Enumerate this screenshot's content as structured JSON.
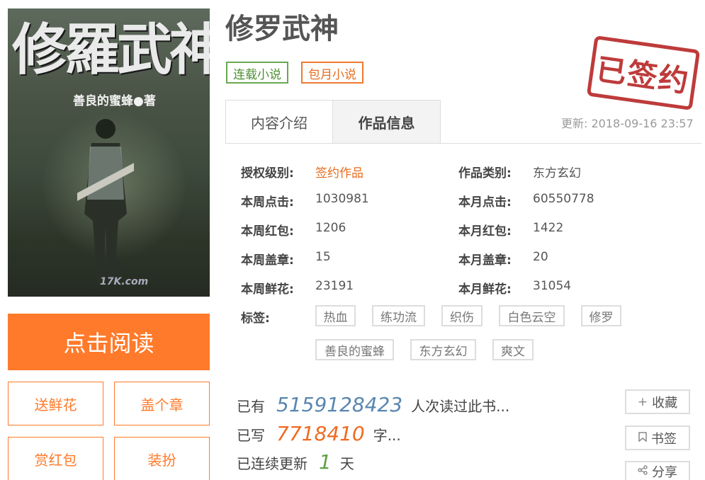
{
  "book": {
    "title": "修罗武神",
    "cover_title": "修羅武神",
    "cover_author": "善良的蜜蜂●著",
    "cover_watermark": "17K.com",
    "tag_serial": "连载小说",
    "tag_monthly": "包月小说",
    "stamp": "已签约"
  },
  "actions": {
    "read": "点击阅读",
    "flower": "送鲜花",
    "stamp_btn": "盖个章",
    "redpacket": "赏红包",
    "dressup": "装扮"
  },
  "tabs": {
    "intro": "内容介绍",
    "info": "作品信息"
  },
  "update": "更新: 2018-09-16 23:57",
  "info": {
    "auth_label": "授权级别:",
    "auth_value": "签约作品",
    "category_label": "作品类别:",
    "category_value": "东方玄幻",
    "week_clicks_label": "本周点击:",
    "week_clicks_value": "1030981",
    "month_clicks_label": "本月点击:",
    "month_clicks_value": "60550778",
    "week_red_label": "本周红包:",
    "week_red_value": "1206",
    "month_red_label": "本月红包:",
    "month_red_value": "1422",
    "week_stamp_label": "本周盖章:",
    "week_stamp_value": "15",
    "month_stamp_label": "本月盖章:",
    "month_stamp_value": "20",
    "week_flower_label": "本周鲜花:",
    "week_flower_value": "23191",
    "month_flower_label": "本月鲜花:",
    "month_flower_value": "31054",
    "tags_label": "标签:"
  },
  "tags": [
    "热血",
    "练功流",
    "织伤",
    "白色云空",
    "修罗",
    "善良的蜜蜂",
    "东方玄幻",
    "爽文"
  ],
  "stats": {
    "read_prefix": "已有",
    "read_count": "5159128423",
    "read_suffix": "人次读过此书...",
    "words_prefix": "已写",
    "words_count": "7718410",
    "words_suffix": "字...",
    "days_prefix": "已连续更新",
    "days_count": "1",
    "days_suffix": "天"
  },
  "side": {
    "collect": "收藏",
    "bookmark": "书签",
    "share": "分享"
  },
  "colors": {
    "accent": "#ff7a2a",
    "serial_green": "#6aa84f",
    "stamp_red": "#b92b2b",
    "read_blue": "#5a86b0"
  }
}
